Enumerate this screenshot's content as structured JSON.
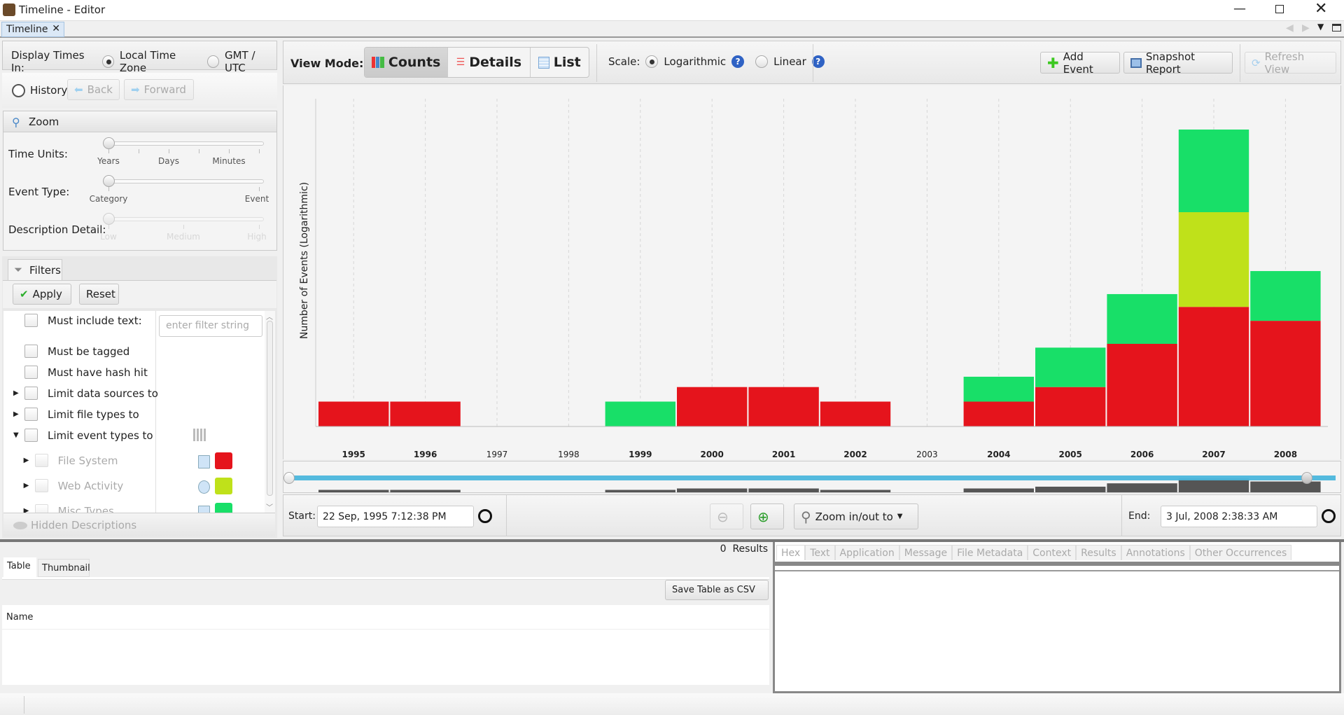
{
  "window": {
    "title": "Timeline - Editor",
    "tab": "Timeline"
  },
  "left": {
    "display_times_label": "Display Times In:",
    "local_tz": "Local Time Zone",
    "gmt": "GMT / UTC",
    "history": "History",
    "back": "Back",
    "forward": "Forward",
    "zoom_title": "Zoom",
    "time_units_label": "Time Units:",
    "time_units_ticks": [
      "Years",
      "Days",
      "Minutes"
    ],
    "time_units_value": "Years",
    "event_type_label": "Event Type:",
    "event_type_ticks": [
      "Category",
      "Event"
    ],
    "event_type_value": "Category",
    "desc_label": "Description Detail:",
    "desc_ticks": [
      "Low",
      "Medium",
      "High"
    ],
    "desc_value": "Low",
    "filters_tab": "Filters",
    "apply": "Apply",
    "reset": "Reset",
    "filter_placeholder": "enter filter string",
    "filters": [
      {
        "label": "Must include text:"
      },
      {
        "label": "Must be tagged"
      },
      {
        "label": "Must have hash hit"
      },
      {
        "label": "Limit data sources to",
        "expand": "collapsed"
      },
      {
        "label": "Limit file types to",
        "expand": "collapsed"
      },
      {
        "label": "Limit event types to",
        "expand": "expanded"
      },
      {
        "label": "File System",
        "expand": "collapsed",
        "disabled": true,
        "color": "#e5141c"
      },
      {
        "label": "Web Activity",
        "expand": "collapsed",
        "disabled": true,
        "color": "#bfe11a"
      },
      {
        "label": "Misc Types",
        "expand": "collapsed",
        "disabled": true,
        "color": "#18df68"
      }
    ],
    "hidden_descriptions": "Hidden Descriptions"
  },
  "toolbar": {
    "view_mode_label": "View Mode:",
    "counts": "Counts",
    "details": "Details",
    "list": "List",
    "active_view": "Counts",
    "scale_label": "Scale:",
    "log": "Logarithmic",
    "linear": "Linear",
    "scale_value": "Logarithmic",
    "add_event": "Add Event",
    "snapshot": "Snapshot Report",
    "refresh": "Refresh View"
  },
  "chart_data": {
    "type": "bar",
    "stacked": true,
    "log_scale": true,
    "grid": true,
    "ylabel": "Number of Events (Logarithmic)",
    "categories": [
      "1995",
      "1996",
      "1997",
      "1998",
      "1999",
      "2000",
      "2001",
      "2002",
      "2003",
      "2004",
      "2005",
      "2006",
      "2007",
      "2008"
    ],
    "series": [
      {
        "color": "#e5141c",
        "values": [
          1,
          1,
          0,
          0,
          0,
          2,
          2,
          1,
          0,
          1,
          2,
          9,
          27,
          18
        ]
      },
      {
        "color": "#bfe11a",
        "values": [
          0,
          0,
          0,
          0,
          0,
          0,
          0,
          0,
          0,
          0,
          0,
          0,
          13,
          0
        ]
      },
      {
        "color": "#18df68",
        "values": [
          0,
          0,
          0,
          0,
          1,
          0,
          0,
          0,
          0,
          1,
          2,
          3,
          9,
          3
        ]
      }
    ]
  },
  "range": {
    "start_label": "Start:",
    "start": "22 Sep, 1995 7:12:38 PM",
    "end_label": "End:",
    "end": "3 Jul, 2008 2:38:33 AM",
    "zoom_menu": "Zoom in/out to"
  },
  "results": {
    "count": "0",
    "label": "Results",
    "tabs": [
      "Table",
      "Thumbnail"
    ],
    "save_csv": "Save Table as CSV",
    "column": "Name"
  },
  "viewer": {
    "tabs": [
      "Hex",
      "Text",
      "Application",
      "Message",
      "File Metadata",
      "Context",
      "Results",
      "Annotations",
      "Other Occurrences"
    ]
  }
}
